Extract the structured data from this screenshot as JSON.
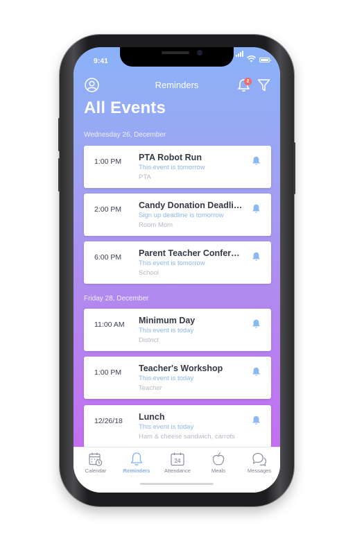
{
  "status_bar": {
    "time": "9:41"
  },
  "header": {
    "title": "Reminders",
    "notification_count": "2",
    "page_title": "All Events"
  },
  "groups": [
    {
      "date": "Wednesday 26, December",
      "events": [
        {
          "time": "1:00 PM",
          "name": "PTA Robot Run",
          "status": "This event is tomorrow",
          "category": "PTA"
        },
        {
          "time": "2:00 PM",
          "name": "Candy Donation Deadline",
          "status": "Sign up deadline is tomorrow",
          "category": "Room Mom"
        },
        {
          "time": "6:00 PM",
          "name": "Parent Teacher Conference",
          "status": "This event is tomorrow",
          "category": "School"
        }
      ]
    },
    {
      "date": "Friday 28, December",
      "events": [
        {
          "time": "11:00 AM",
          "name": "Minimum Day",
          "status": "This event is today",
          "category": "District"
        },
        {
          "time": "1:00 PM",
          "name": "Teacher's Workshop",
          "status": "This event is today",
          "category": "Teacher"
        },
        {
          "time": "12/26/18",
          "name": "Lunch",
          "status": "This event is today",
          "category": "Ham & cheese sandwich, carrots"
        }
      ]
    }
  ],
  "tabbar": {
    "items": [
      {
        "label": "Calendar",
        "icon": "calendar-icon",
        "active": false
      },
      {
        "label": "Reminders",
        "icon": "bell-icon",
        "active": true
      },
      {
        "label": "Attendance",
        "icon": "attendance-calendar-icon",
        "date": "24",
        "active": false
      },
      {
        "label": "Meals",
        "icon": "apple-icon",
        "active": false
      },
      {
        "label": "Messages",
        "icon": "chat-bubbles-icon",
        "active": false
      }
    ]
  },
  "colors": {
    "gradient_top": "#8ab2f8",
    "gradient_bottom": "#c26ff0",
    "accent_blue": "#8bb8f1",
    "badge": "#f06a6a"
  }
}
